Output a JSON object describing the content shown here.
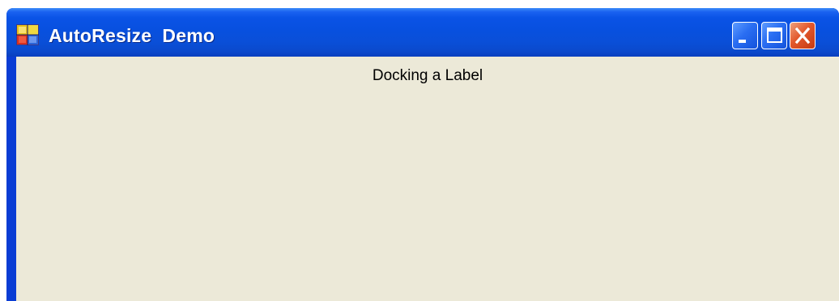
{
  "window": {
    "title": "AutoResize  Demo",
    "icon": "app-window-icon",
    "caption_buttons": {
      "minimize": "minimize-icon",
      "maximize": "maximize-icon",
      "close": "close-icon"
    }
  },
  "client": {
    "label_text": "Docking a Label"
  },
  "colors": {
    "titlebar": "#0a53e6",
    "client_background": "#ece9d8",
    "close_button": "#e2582c",
    "caption_button": "#2a6ef2"
  }
}
